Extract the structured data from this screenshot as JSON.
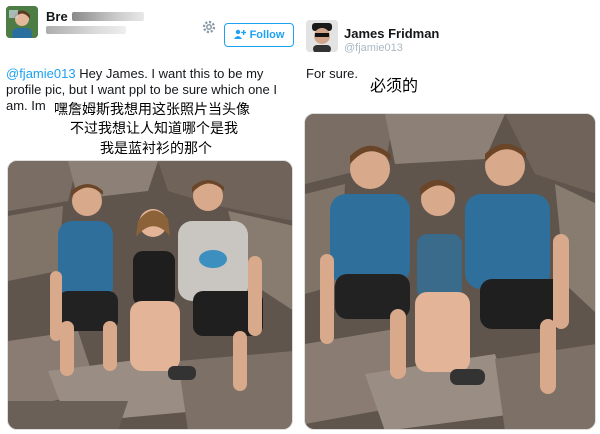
{
  "left": {
    "user_name": "Bre",
    "follow_label": "Follow",
    "mention": "@fjamie013",
    "tweet_body": " Hey James. I want this to be my profile pic, but I want ppl to be sure which one I am. Im",
    "cn_line1": "嘿詹姆斯我想用这张照片当头像",
    "cn_line2": "不过我想让人知道哪个是我",
    "cn_line3": "我是蓝衬衫的那个"
  },
  "right": {
    "user_name": "James Fridman",
    "handle": "@fjamie013",
    "reply_text": "For sure.",
    "cn_reply": "必须的"
  },
  "colors": {
    "twitter_blue": "#1da1f2",
    "muted": "#aab8c2",
    "shirt_blue": "#2f6f9c",
    "rock": "#6e6259"
  },
  "icons": [
    "gear-icon",
    "add-user-icon"
  ]
}
